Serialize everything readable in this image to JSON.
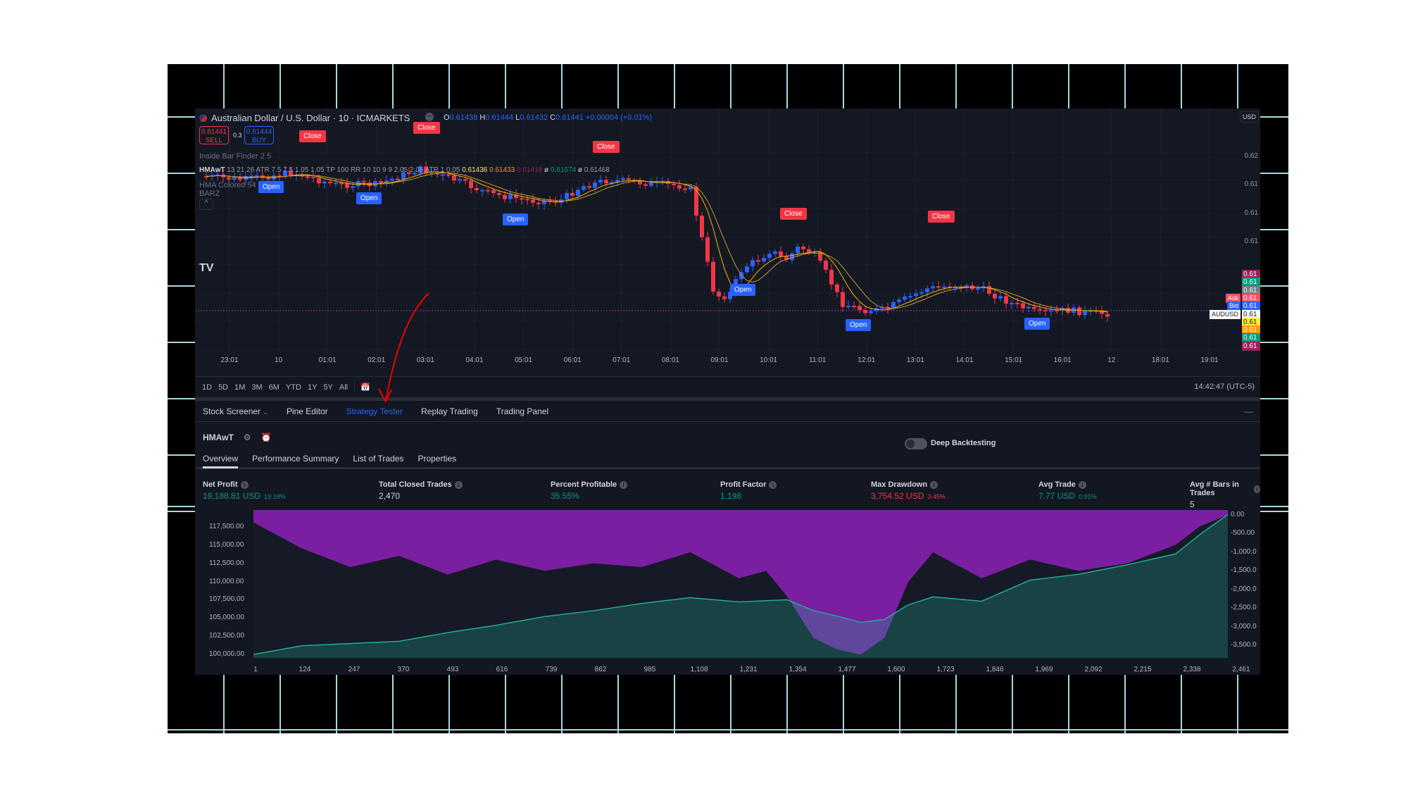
{
  "chart": {
    "symbol": "Australian Dollar / U.S. Dollar · 10 · ICMARKETS",
    "ohlc": {
      "o_label": "O",
      "o": "0.61438",
      "h_label": "H",
      "h": "0.61444",
      "l_label": "L",
      "l": "0.61432",
      "c_label": "C",
      "c": "0.61441",
      "change": "+0.00004 (+0.01%)"
    },
    "sell": {
      "price": "0.61441",
      "label": "SELL"
    },
    "spread": "0.3",
    "buy": {
      "price": "0.61444",
      "label": "BUY"
    },
    "indicators": [
      {
        "name": "Inside Bar Finder 2 5"
      },
      {
        "name": "HMAwT",
        "params": "13 21 26 ATR 7.5 7.5 1.05 1.05 TP 100 RR 10 10 9 9 2.05 2.05 ATR 1 0.05",
        "values": [
          "0.61436",
          "0.61433",
          "0.61418",
          "ø",
          "0.61574",
          "ø",
          "0.61468"
        ]
      },
      {
        "name": "HMA Colored 54"
      },
      {
        "name": "BARZ"
      }
    ],
    "currency": "USD",
    "price_labels": [
      "0.62",
      "0.61",
      "0.61",
      "0.61"
    ],
    "price_boxes": [
      {
        "label": "",
        "value": "0.61",
        "color": "#9c1f5a"
      },
      {
        "label": "",
        "value": "0.61",
        "color": "#089981"
      },
      {
        "label": "",
        "value": "0.61",
        "color": "#787b86"
      },
      {
        "label": "Ask",
        "value": "0.61",
        "color": "#f7525f"
      },
      {
        "label": "Bid",
        "value": "0.61",
        "color": "#2962ff"
      },
      {
        "label": "AUDUSD",
        "value": "0.61",
        "color": "#ffffff"
      },
      {
        "label": "",
        "value": "0.61",
        "color": "#ffeb3b"
      },
      {
        "label": "",
        "value": "0.61",
        "color": "#ff9800"
      },
      {
        "label": "",
        "value": "0.61",
        "color": "#089981"
      },
      {
        "label": "",
        "value": "0.61",
        "color": "#9c1f5a"
      }
    ],
    "trade_labels": {
      "close": "Close",
      "open": "Open"
    },
    "time_labels": [
      "23:01",
      "10",
      "01:01",
      "02:01",
      "03:01",
      "04:01",
      "05:01",
      "06:01",
      "07:01",
      "08:01",
      "09:01",
      "10:01",
      "11:01",
      "12:01",
      "13:01",
      "14:01",
      "15:01",
      "16:01",
      "12",
      "18:01",
      "19:01"
    ]
  },
  "range_buttons": [
    "1D",
    "5D",
    "1M",
    "3M",
    "6M",
    "YTD",
    "1Y",
    "5Y",
    "All"
  ],
  "clock": "14:42:47 (UTC-5)",
  "bottom_tabs": [
    {
      "label": "Stock Screener",
      "active": false
    },
    {
      "label": "Pine Editor",
      "active": false
    },
    {
      "label": "Strategy Tester",
      "active": true
    },
    {
      "label": "Replay Trading",
      "active": false
    },
    {
      "label": "Trading Panel",
      "active": false
    }
  ],
  "strategy": {
    "name": "HMAwT",
    "deep_backtesting_label": "Deep Backtesting",
    "deep_backtesting_on": false
  },
  "sub_tabs": [
    {
      "label": "Overview",
      "active": true
    },
    {
      "label": "Performance Summary"
    },
    {
      "label": "List of Trades"
    },
    {
      "label": "Properties"
    }
  ],
  "metrics": [
    {
      "label": "Net Profit",
      "value": "19,188.81 USD",
      "pct": "19.19%",
      "color": "green"
    },
    {
      "label": "Total Closed Trades",
      "value": "2,470",
      "pct": "",
      "color": "white"
    },
    {
      "label": "Percent Profitable",
      "value": "35.55%",
      "pct": "",
      "color": "green"
    },
    {
      "label": "Profit Factor",
      "value": "1.198",
      "pct": "",
      "color": "green"
    },
    {
      "label": "Max Drawdown",
      "value": "3,754.52 USD",
      "pct": "3.45%",
      "color": "red"
    },
    {
      "label": "Avg Trade",
      "value": "7.77 USD",
      "pct": "0.01%",
      "color": "green"
    },
    {
      "label": "Avg # Bars in Trades",
      "value": "5",
      "pct": "",
      "color": "white"
    }
  ],
  "equity_chart": {
    "type": "area",
    "equity_axis_labels": [
      "117,500.00",
      "115,000.00",
      "112,500.00",
      "110,000.00",
      "107,500.00",
      "105,000.00",
      "102,500.00",
      "100,000.00"
    ],
    "drawdown_axis_labels": [
      "0.00",
      "-500.00",
      "-1,000.0",
      "-1,500.0",
      "-2,000.0",
      "-2,500.0",
      "-3,000.0",
      "-3,500.0"
    ],
    "x_labels": [
      "1",
      "124",
      "247",
      "370",
      "493",
      "616",
      "739",
      "862",
      "985",
      "1,108",
      "1,231",
      "1,354",
      "1,477",
      "1,600",
      "1,723",
      "1,846",
      "1,969",
      "2,092",
      "2,215",
      "2,338",
      "2,461"
    ],
    "equity_ylim": [
      100000,
      117500
    ],
    "drawdown_ylim": [
      -3500,
      0
    ],
    "equity": [
      [
        1,
        100000
      ],
      [
        124,
        101200
      ],
      [
        247,
        101500
      ],
      [
        370,
        101800
      ],
      [
        493,
        103000
      ],
      [
        616,
        104000
      ],
      [
        739,
        105200
      ],
      [
        862,
        106000
      ],
      [
        985,
        107000
      ],
      [
        1108,
        107800
      ],
      [
        1231,
        107200
      ],
      [
        1354,
        107500
      ],
      [
        1420,
        106000
      ],
      [
        1477,
        105300
      ],
      [
        1540,
        104400
      ],
      [
        1600,
        104800
      ],
      [
        1660,
        106800
      ],
      [
        1723,
        107900
      ],
      [
        1846,
        107300
      ],
      [
        1969,
        110200
      ],
      [
        2092,
        111000
      ],
      [
        2215,
        112300
      ],
      [
        2338,
        113800
      ],
      [
        2400,
        116500
      ],
      [
        2470,
        119200
      ]
    ],
    "drawdown": [
      [
        1,
        -200
      ],
      [
        124,
        -900
      ],
      [
        247,
        -1400
      ],
      [
        370,
        -1100
      ],
      [
        493,
        -1600
      ],
      [
        616,
        -1200
      ],
      [
        739,
        -1500
      ],
      [
        862,
        -1300
      ],
      [
        985,
        -1400
      ],
      [
        1108,
        -1000
      ],
      [
        1231,
        -1700
      ],
      [
        1300,
        -1500
      ],
      [
        1354,
        -2200
      ],
      [
        1420,
        -3300
      ],
      [
        1477,
        -3600
      ],
      [
        1540,
        -3750
      ],
      [
        1600,
        -3300
      ],
      [
        1660,
        -1800
      ],
      [
        1723,
        -1000
      ],
      [
        1846,
        -1700
      ],
      [
        1969,
        -1200
      ],
      [
        2092,
        -1500
      ],
      [
        2215,
        -1300
      ],
      [
        2338,
        -800
      ],
      [
        2400,
        -300
      ],
      [
        2470,
        0
      ]
    ],
    "equity_color": "#22ab94",
    "drawdown_color": "#7b1fa2"
  }
}
